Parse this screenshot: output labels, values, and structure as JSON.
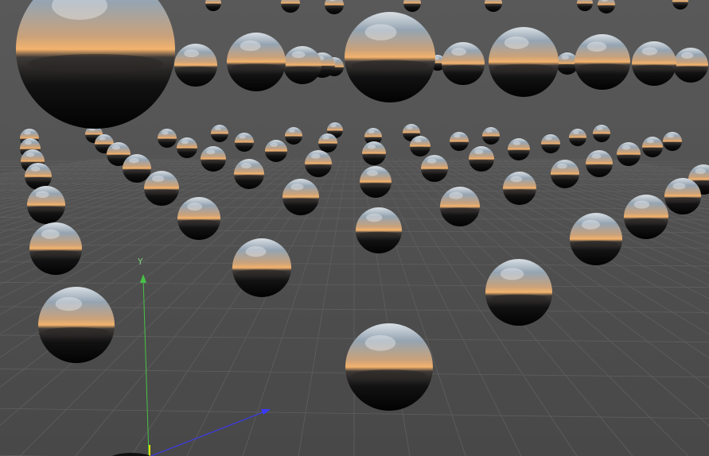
{
  "viewport": {
    "name": "3d-viewport",
    "background_color": "#555555",
    "grid_color": "#5f5f5f"
  },
  "axes": {
    "y_label": "Y",
    "x_color": "#3a3aff",
    "y_color": "#47c247",
    "z_color": "#e0e000"
  },
  "spheres": {
    "material": "reflective-chrome",
    "environment": "sunset-coastline",
    "colors": {
      "sky_top": "#8fa3b5",
      "horizon_glow": "#f0b574",
      "land": "#3a3a3a",
      "bottom": "#0a0a0a"
    }
  }
}
